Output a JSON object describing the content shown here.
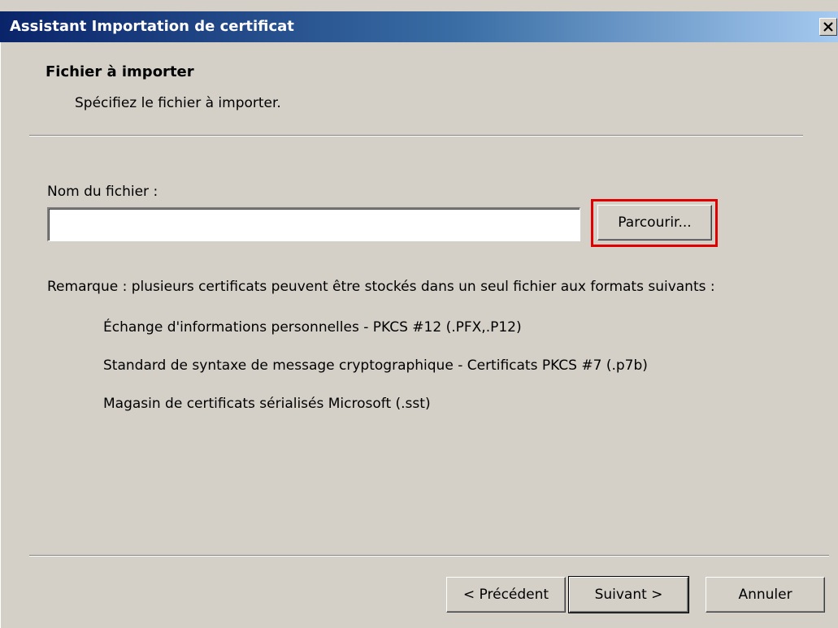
{
  "window": {
    "title": "Assistant Importation de certificat"
  },
  "header": {
    "title": "Fichier à importer",
    "subtitle": "Spécifiez le fichier à importer."
  },
  "file": {
    "label": "Nom du fichier :",
    "value": "",
    "browse_label": "Parcourir..."
  },
  "remark": {
    "text": "Remarque : plusieurs certificats peuvent être stockés dans un seul fichier aux formats suivants :",
    "formats": [
      "Échange d'informations personnelles - PKCS #12 (.PFX,.P12)",
      "Standard de syntaxe de message cryptographique - Certificats PKCS #7 (.p7b)",
      "Magasin de certificats sérialisés Microsoft (.sst)"
    ]
  },
  "footer": {
    "back_label": "< Précédent",
    "next_label": "Suivant >",
    "cancel_label": "Annuler"
  },
  "colors": {
    "highlight": "#e00000",
    "titlebar_start": "#0a246a",
    "titlebar_end": "#a6caf0",
    "face": "#d4d0c8"
  },
  "icons": {
    "close": "close-icon"
  }
}
